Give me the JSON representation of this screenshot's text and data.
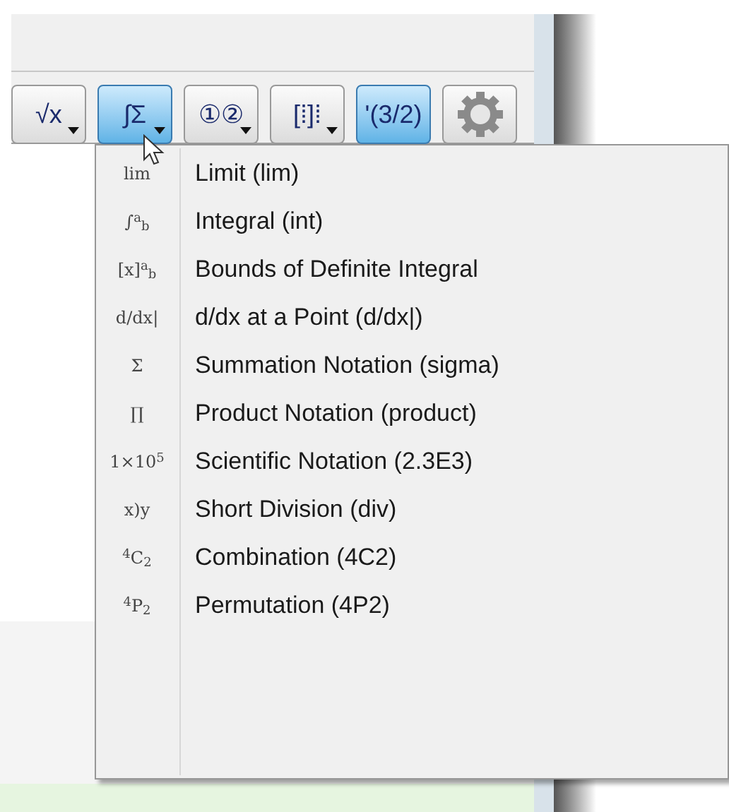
{
  "toolbar": [
    {
      "kind": "glyph",
      "glyph": "√x",
      "selected": false,
      "dropdown": true
    },
    {
      "kind": "glyph",
      "glyph": "∫Σ",
      "selected": true,
      "dropdown": true
    },
    {
      "kind": "glyph",
      "glyph": "①②",
      "selected": false,
      "dropdown": true
    },
    {
      "kind": "glyph",
      "glyph": "[⁞]⁞",
      "selected": false,
      "dropdown": true
    },
    {
      "kind": "glyph",
      "glyph": "'(3/2)",
      "selected": true,
      "dropdown": false
    },
    {
      "kind": "gear",
      "selected": false,
      "dropdown": false
    }
  ],
  "menu": [
    {
      "icon": "lim",
      "label": "Limit (lim)"
    },
    {
      "icon": "∫$^{a}$$_{b}$",
      "label": "Integral (int)"
    },
    {
      "icon": "[x]$^{a}$$_{b}$",
      "label": "Bounds of Definite Integral"
    },
    {
      "icon": "d/dx|",
      "label": "d/dx at a Point (d/dx|)"
    },
    {
      "icon": "Σ",
      "label": "Summation Notation (sigma)"
    },
    {
      "icon": "∏",
      "label": "Product Notation (product)"
    },
    {
      "icon": "1×10$^{5}$",
      "label": "Scientific Notation (2.3E3)"
    },
    {
      "icon": "x)y",
      "label": "Short Division (div)"
    },
    {
      "icon": "$^{4}$C$_{2}$",
      "label": "Combination (4C2)"
    },
    {
      "icon": "$^{4}$P$_{2}$",
      "label": "Permutation (4P2)"
    }
  ]
}
